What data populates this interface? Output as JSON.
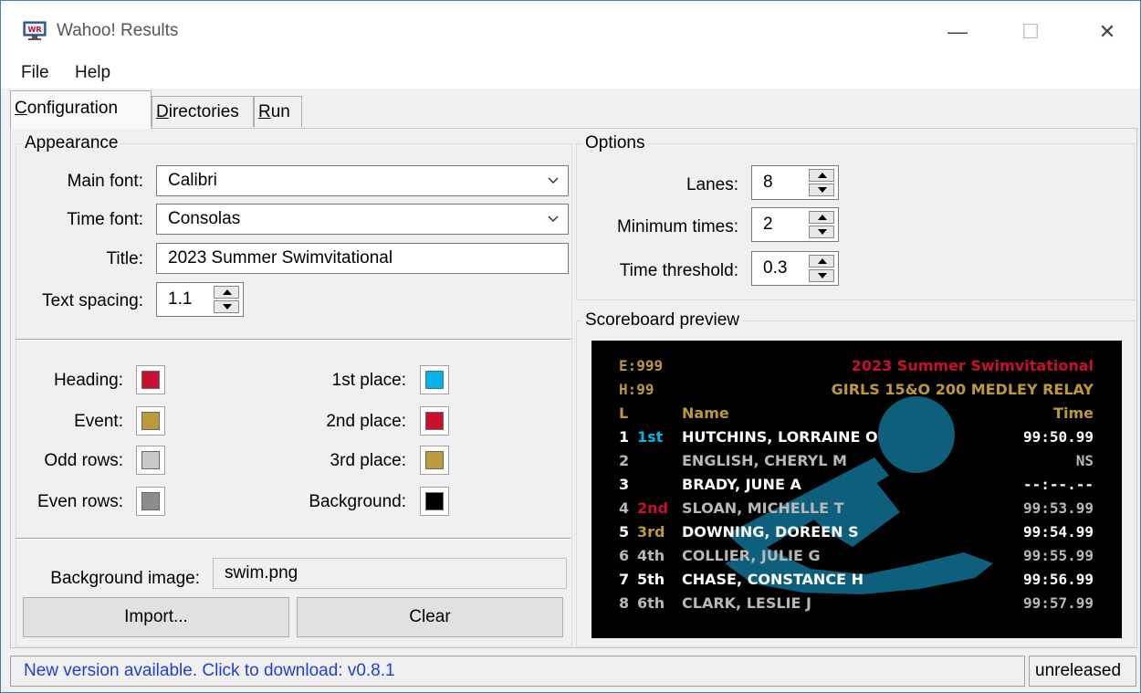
{
  "window": {
    "title": "Wahoo! Results",
    "minimize": "—",
    "maximize": "☐",
    "close": "✕"
  },
  "menu": {
    "file": "File",
    "help": "Help"
  },
  "tabs": {
    "configuration": {
      "label": "Configuration",
      "access": "C",
      "rest": "onfiguration"
    },
    "directories": {
      "label": "Directories",
      "access": "D",
      "rest": "irectories"
    },
    "run": {
      "label": "Run",
      "access": "R",
      "rest": "un"
    }
  },
  "appearance": {
    "label": "Appearance",
    "main_font_label": "Main font:",
    "main_font": "Calibri",
    "time_font_label": "Time font:",
    "time_font": "Consolas",
    "title_label": "Title:",
    "title": "2023 Summer Swimvitational",
    "text_spacing_label": "Text spacing:",
    "text_spacing": "1.1"
  },
  "colors": {
    "heading_label": "Heading:",
    "heading": "#c8102e",
    "event_label": "Event:",
    "event": "#bc9a3a",
    "odd_rows_label": "Odd rows:",
    "odd_rows": "#c8c8c8",
    "even_rows_label": "Even rows:",
    "even_rows": "#8c8c8c",
    "first_label": "1st place:",
    "first": "#00b4e6",
    "second_label": "2nd place:",
    "second": "#c8102e",
    "third_label": "3rd place:",
    "third": "#bc9a3a",
    "background_label": "Background:",
    "background": "#000000"
  },
  "background_image": {
    "label": "Background image:",
    "value": "swim.png",
    "import_label": "Import...",
    "clear_label": "Clear"
  },
  "options": {
    "label": "Options",
    "lanes_label": "Lanes:",
    "lanes": "8",
    "min_times_label": "Minimum times:",
    "min_times": "2",
    "threshold_label": "Time threshold:",
    "threshold": "0.3"
  },
  "preview": {
    "label": "Scoreboard preview",
    "event": "E:999",
    "heat": "H:99",
    "title": "2023 Summer Swimvitational",
    "event_name": "GIRLS 15&O 200 MEDLEY RELAY",
    "header": {
      "lane": "L",
      "name": "Name",
      "time": "Time"
    },
    "rows": [
      {
        "lane": "1",
        "place": "1st",
        "name": "HUTCHINS, LORRAINE O",
        "time": "99:50.99"
      },
      {
        "lane": "2",
        "place": "",
        "name": "ENGLISH, CHERYL M",
        "time": "NS"
      },
      {
        "lane": "3",
        "place": "",
        "name": "BRADY, JUNE A",
        "time": "--:--.--"
      },
      {
        "lane": "4",
        "place": "2nd",
        "name": "SLOAN, MICHELLE T",
        "time": "99:53.99"
      },
      {
        "lane": "5",
        "place": "3rd",
        "name": "DOWNING, DOREEN S",
        "time": "99:54.99"
      },
      {
        "lane": "6",
        "place": "4th",
        "name": "COLLIER, JULIE G",
        "time": "99:55.99"
      },
      {
        "lane": "7",
        "place": "5th",
        "name": "CHASE, CONSTANCE H",
        "time": "99:56.99"
      },
      {
        "lane": "8",
        "place": "6th",
        "name": "CLARK, LESLIE J",
        "time": "99:57.99"
      }
    ]
  },
  "status": {
    "message": "New version available. Click to download: v0.8.1",
    "version": "unreleased"
  }
}
